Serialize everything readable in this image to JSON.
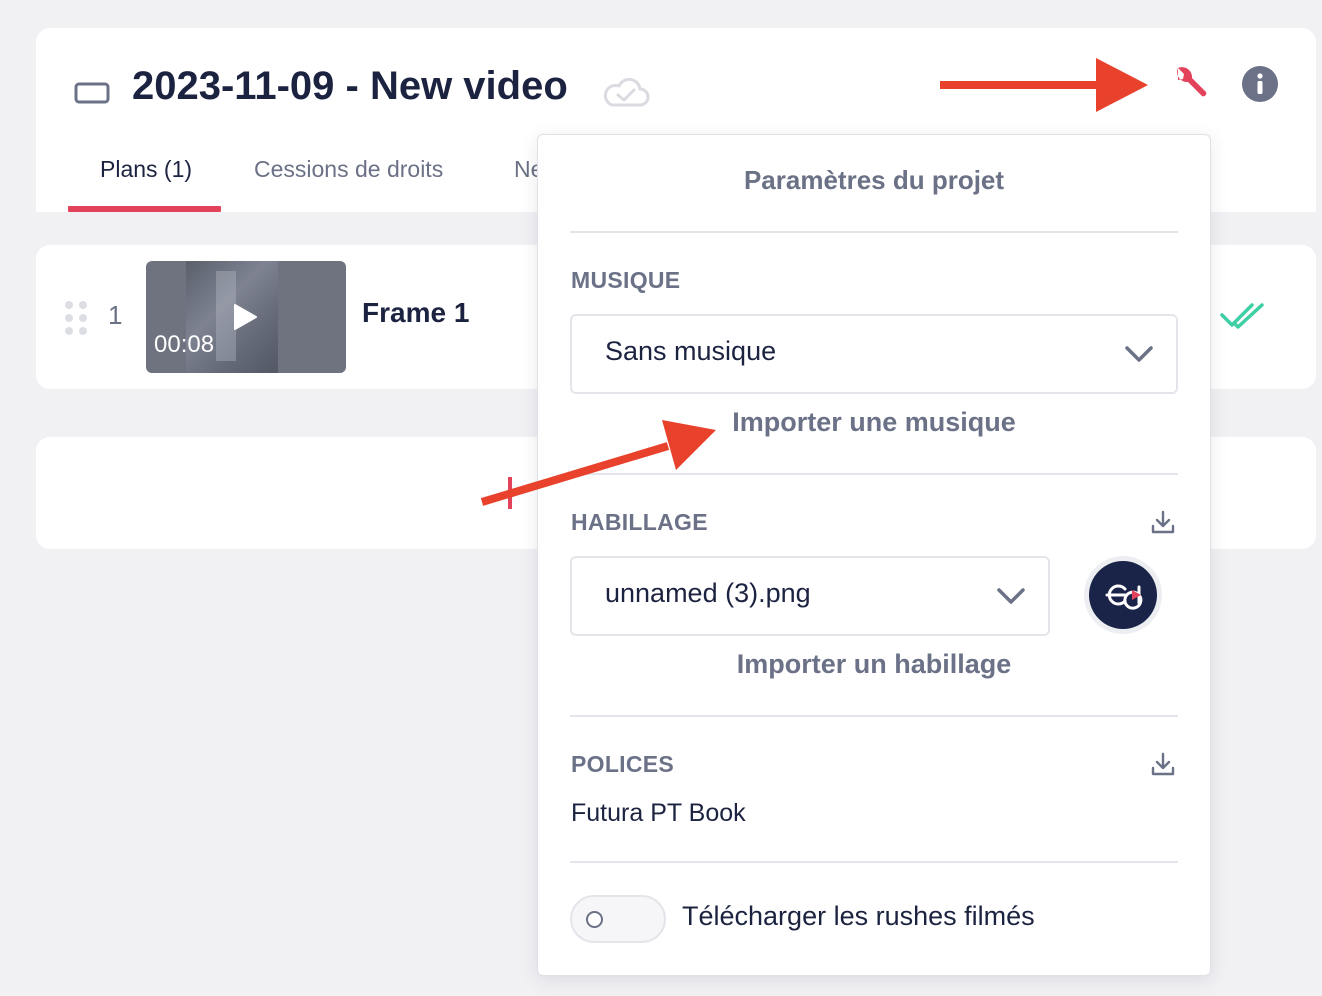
{
  "header": {
    "title": "2023-11-09 - New video",
    "tabs": [
      {
        "label": "Plans (1)",
        "active": true
      },
      {
        "label": "Cessions de droits",
        "active": false
      },
      {
        "label": "Ne",
        "active": false
      }
    ]
  },
  "frames": [
    {
      "index": "1",
      "duration": "00:08",
      "name": "Frame 1"
    }
  ],
  "settings": {
    "title": "Paramètres du projet",
    "music": {
      "label": "MUSIQUE",
      "selected": "Sans musique",
      "import_link": "Importer une musique"
    },
    "overlay": {
      "label": "HABILLAGE",
      "selected": "unnamed (3).png",
      "import_link": "Importer un habillage"
    },
    "fonts": {
      "label": "POLICES",
      "value": "Futura PT Book"
    },
    "download_rushes": {
      "label": "Télécharger les rushes filmés",
      "enabled": false
    }
  },
  "colors": {
    "accent": "#e2435a",
    "annotation_arrow": "#e8412c",
    "success": "#3ecfa5",
    "text_dark": "#1c2340",
    "text_muted": "#6b7186"
  }
}
